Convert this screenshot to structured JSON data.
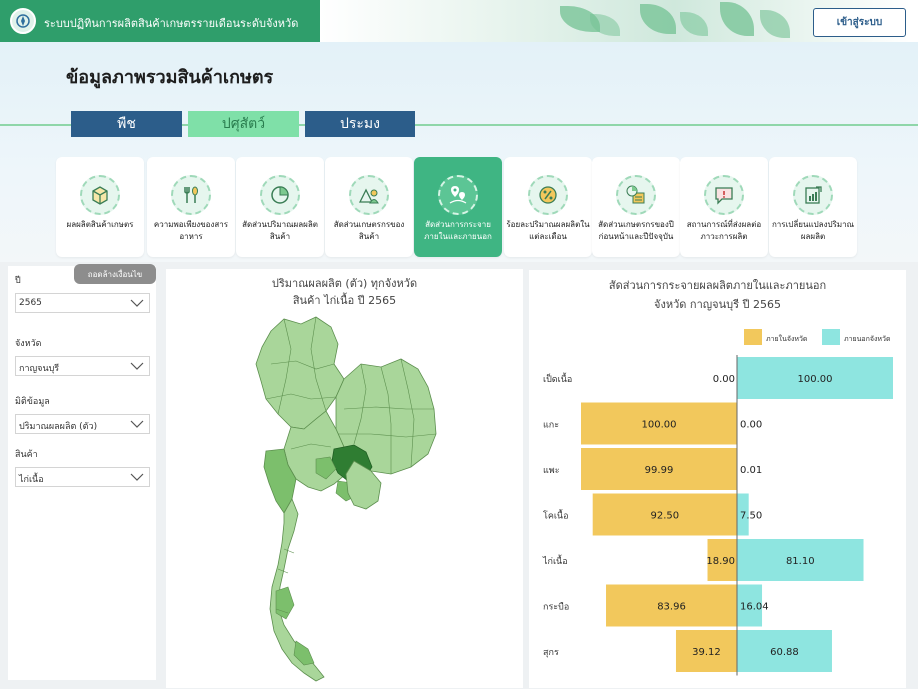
{
  "header": {
    "title": "ระบบปฏิทินการผลิตสินค้าเกษตรรายเดือนระดับจังหวัด",
    "login_label": "เข้าสู่ระบบ"
  },
  "page_title": "ข้อมูลภาพรวมสินค้าเกษตร",
  "tabs": [
    {
      "label": "พืช"
    },
    {
      "label": "ปศุสัตว์",
      "active": true
    },
    {
      "label": "ประมง"
    }
  ],
  "cards": [
    {
      "label": "ผลผลิตสินค้าเกษตร",
      "icon": "box-icon"
    },
    {
      "label": "ความพอเพียงของสารอาหาร",
      "icon": "utensils-icon"
    },
    {
      "label": "สัดส่วนปริมาณผลผลิตสินค้า",
      "icon": "pie-chart-icon"
    },
    {
      "label": "สัดส่วนเกษตรกรของสินค้า",
      "icon": "farmer-icon"
    },
    {
      "label": "สัดส่วนการกระจายภายในและภายนอก",
      "icon": "map-pin-icon",
      "active": true
    },
    {
      "label": "ร้อยละปริมาณผลผลิตในแต่ละเดือน",
      "icon": "percent-icon"
    },
    {
      "label": "สัดส่วนเกษตรกรของปีก่อนหน้าและปีปัจจุบัน",
      "icon": "calendar-chart-icon"
    },
    {
      "label": "สถานการณ์ที่ส่งผลต่อภาวะการผลิต",
      "icon": "alert-chat-icon"
    },
    {
      "label": "การเปลี่ยนแปลงปริมาณผลผลิต",
      "icon": "bar-trend-icon"
    }
  ],
  "filters": {
    "clear_label": "ถอดล้างเงื่อนไข",
    "year": {
      "label": "ปี",
      "value": "2565"
    },
    "province": {
      "label": "จังหวัด",
      "value": "กาญจนบุรี"
    },
    "dimension": {
      "label": "มิติข้อมูล",
      "value": "ปริมาณผลผลิต (ตัว)"
    },
    "product": {
      "label": "สินค้า",
      "value": "ไก่เนื้อ"
    }
  },
  "map": {
    "title_line1": "ปริมาณผลผลิต (ตัว) ทุกจังหวัด",
    "title_line2": "สินค้า ไก่เนื้อ ปี 2565",
    "colors": {
      "light": "#a9d69a",
      "mid": "#7cbf6c",
      "dark": "#2f7d32",
      "outline": "#5c8f4e"
    }
  },
  "chart_data": {
    "type": "bar",
    "orientation": "horizontal-diverging",
    "title": "สัดส่วนการกระจายผลผลิตภายในและภายนอก จังหวัด กาญจนบุรี ปี 2565",
    "title_line1": "สัดส่วนการกระจายผลผลิตภายในและภายนอก",
    "title_line2": "จังหวัด กาญจนบุรี ปี 2565",
    "legend_position": "top-right",
    "xlim": [
      -100,
      100
    ],
    "categories": [
      "เป็ดเนื้อ",
      "แกะ",
      "แพะ",
      "โคเนื้อ",
      "ไก่เนื้อ",
      "กระบือ",
      "สุกร"
    ],
    "series": [
      {
        "name": "ภายในจังหวัด",
        "color": "#f2c85c",
        "values": [
          0.0,
          100.0,
          99.99,
          92.5,
          18.9,
          83.96,
          39.12
        ]
      },
      {
        "name": "ภายนอกจังหวัด",
        "color": "#8ee5e0",
        "values": [
          100.0,
          0.0,
          0.01,
          7.5,
          81.1,
          16.04,
          60.88
        ]
      }
    ]
  }
}
